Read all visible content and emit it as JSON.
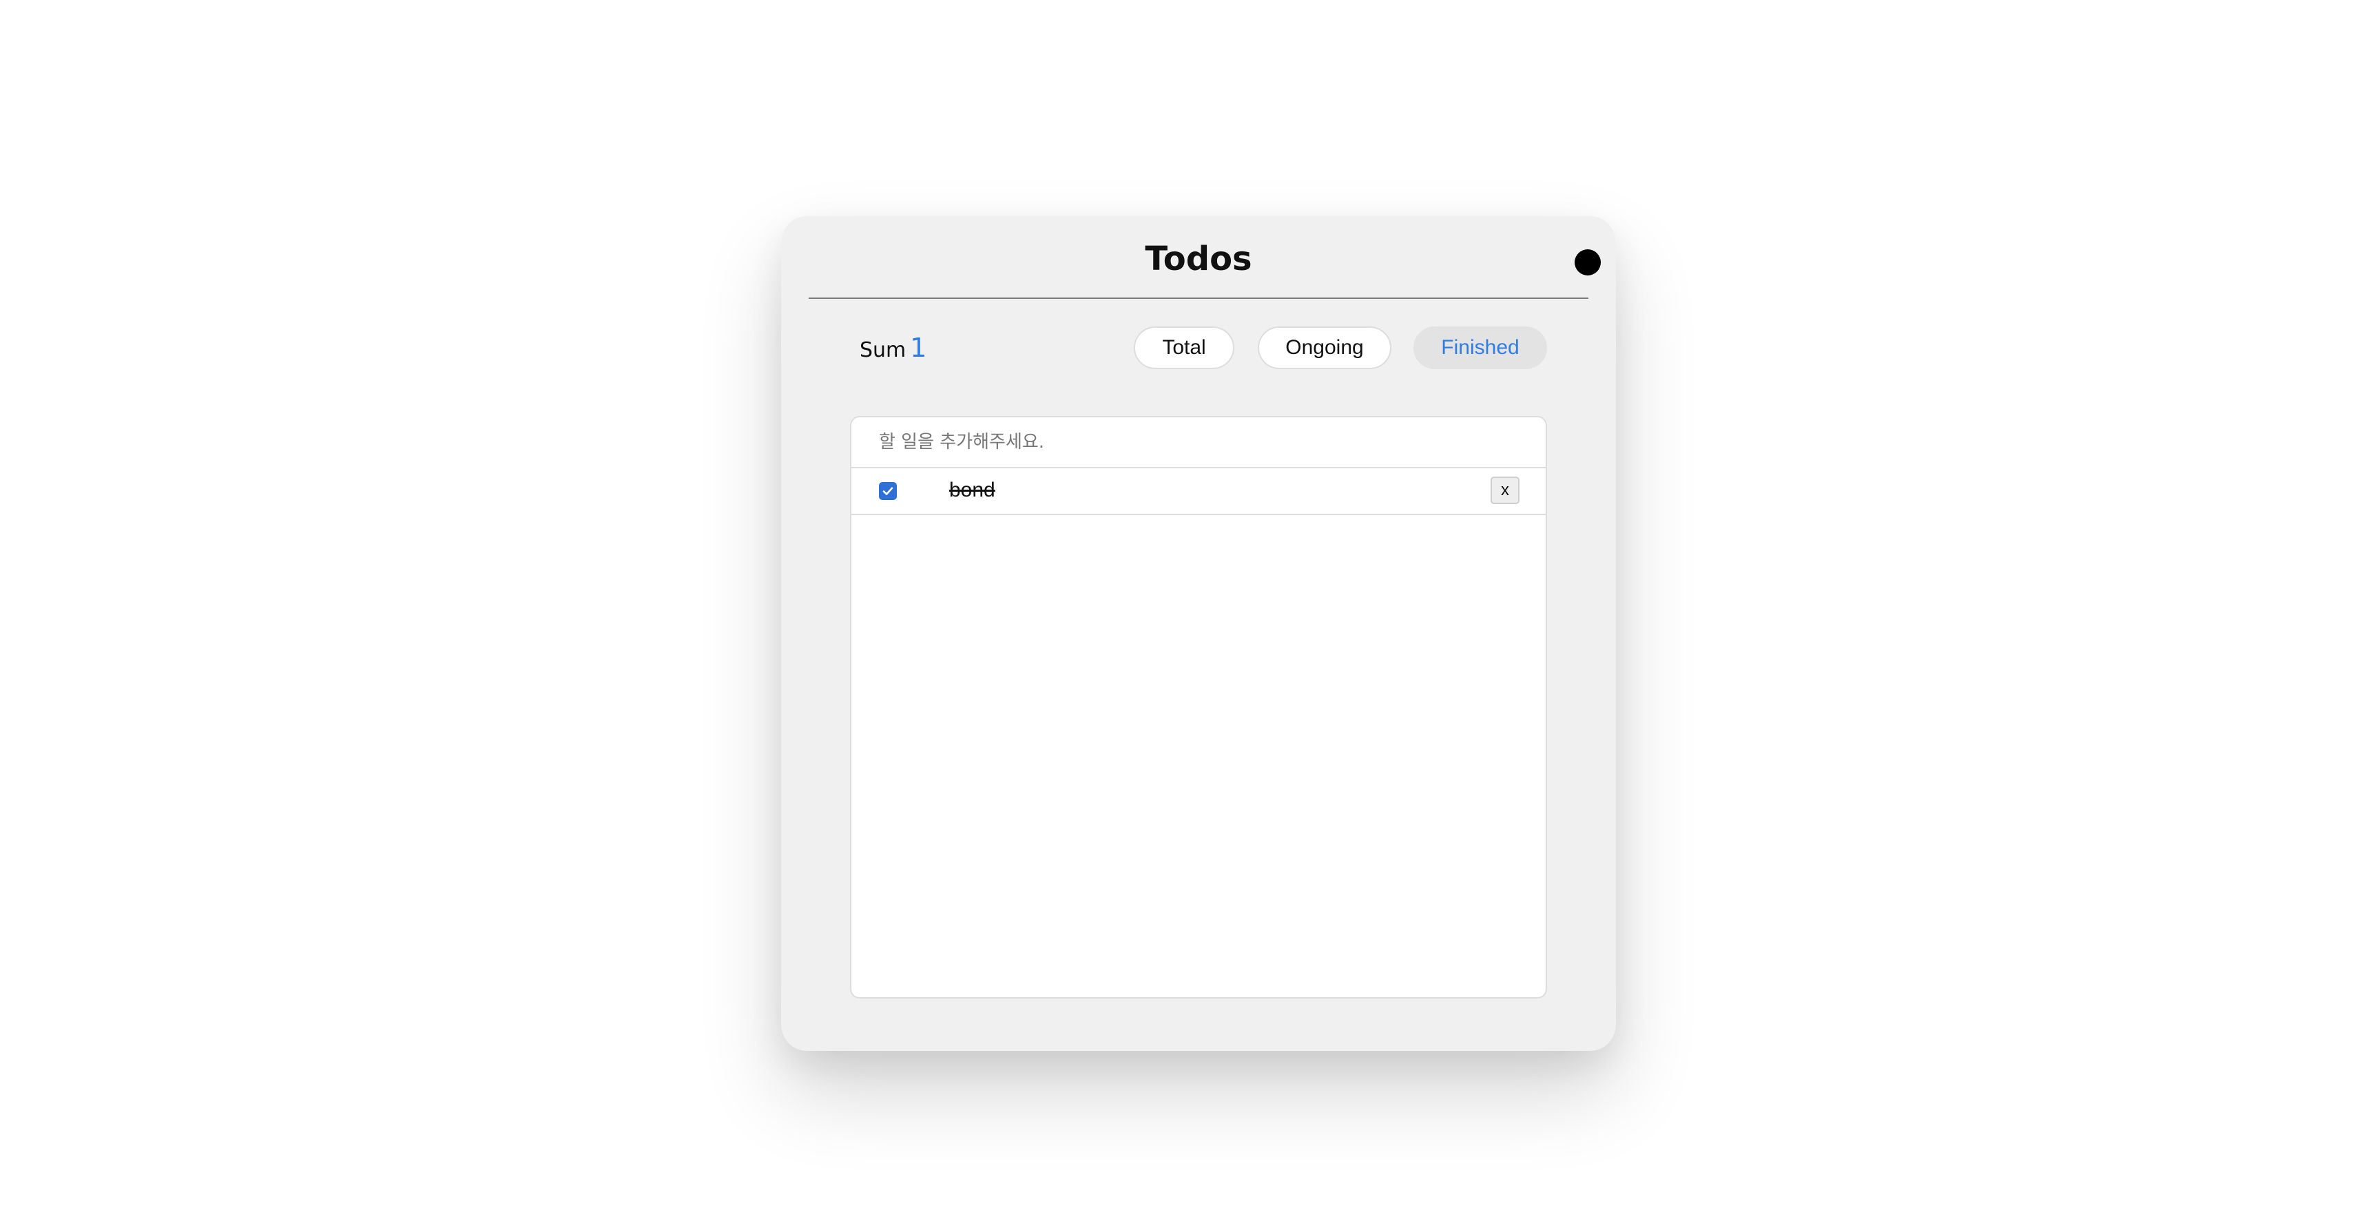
{
  "header": {
    "title": "Todos"
  },
  "summary": {
    "label": "Sum",
    "count": "1"
  },
  "filters": {
    "total": "Total",
    "ongoing": "Ongoing",
    "finished": "Finished",
    "active": "finished"
  },
  "input": {
    "placeholder": "할 일을 추가해주세요.",
    "value": ""
  },
  "todos": [
    {
      "text": "bond",
      "completed": true,
      "delete_label": "x"
    }
  ],
  "colors": {
    "accent": "#2f7de1",
    "card_background": "#f0f0f0",
    "toggle_dot": "#000000"
  }
}
